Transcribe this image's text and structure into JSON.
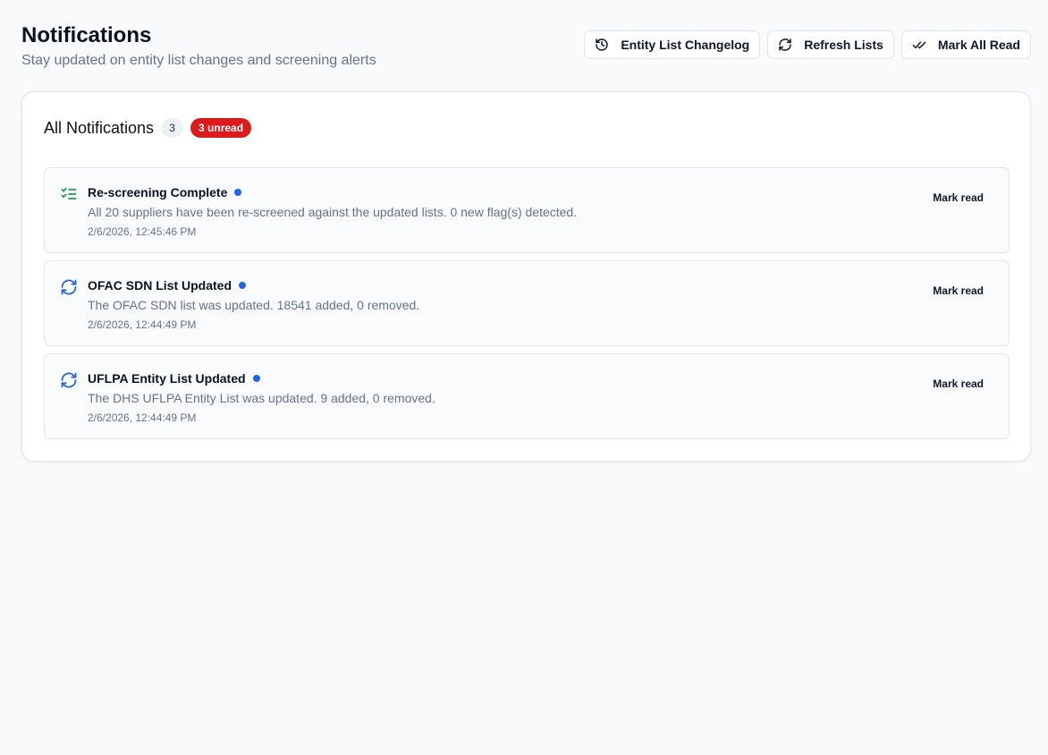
{
  "header": {
    "title": "Notifications",
    "subtitle": "Stay updated on entity list changes and screening alerts"
  },
  "actions": {
    "changelog_label": "Entity List Changelog",
    "refresh_label": "Refresh Lists",
    "mark_all_label": "Mark All Read"
  },
  "card": {
    "title": "All Notifications",
    "count": "3",
    "unread": "3 unread"
  },
  "notifications": [
    {
      "icon": "list-checks-icon",
      "title": "Re-screening Complete",
      "message": "All 20 suppliers have been re-screened against the updated lists. 0 new flag(s) detected.",
      "time": "2/6/2026, 12:45:46 PM",
      "action": "Mark read"
    },
    {
      "icon": "refresh-icon",
      "title": "OFAC SDN List Updated",
      "message": "The OFAC SDN list was updated. 18541 added, 0 removed.",
      "time": "2/6/2026, 12:44:49 PM",
      "action": "Mark read"
    },
    {
      "icon": "refresh-icon",
      "title": "UFLPA Entity List Updated",
      "message": "The DHS UFLPA Entity List was updated. 9 added, 0 removed.",
      "time": "2/6/2026, 12:44:49 PM",
      "action": "Mark read"
    }
  ],
  "colors": {
    "accent_blue": "#2563eb",
    "success_green": "#16a34a",
    "unread_red": "#dc1c1c"
  }
}
